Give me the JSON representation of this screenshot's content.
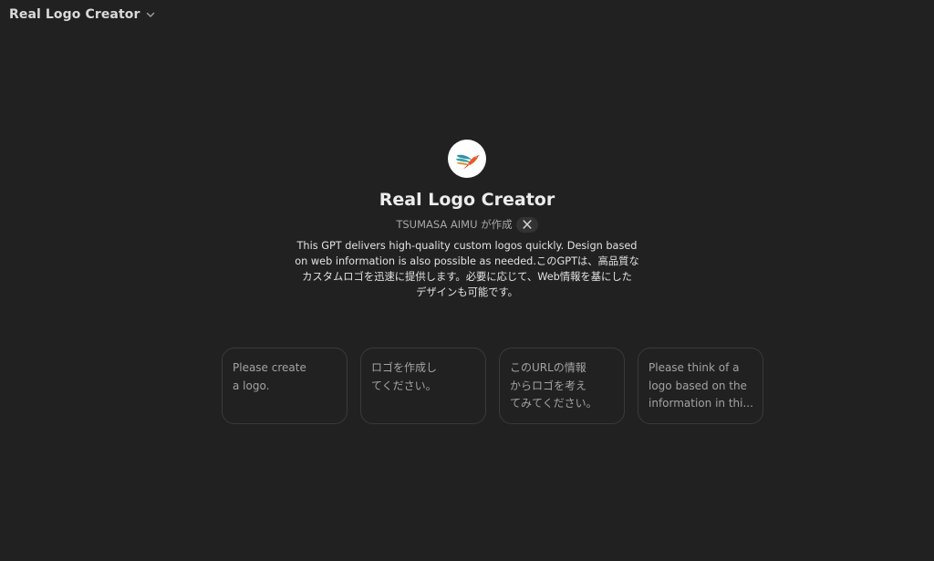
{
  "header": {
    "title": "Real Logo Creator"
  },
  "gpt": {
    "name": "Real Logo Creator",
    "author": "TSUMASA AIMU が作成",
    "description_lines": [
      "This GPT delivers high-quality custom logos quickly. Design based",
      "on web information is also possible as needed.このGPTは、高品質な",
      "カスタムロゴを迅速に提供します。必要に応じて、Web情報を基にした",
      "デザインも可能です。"
    ]
  },
  "starters": [
    {
      "lines": [
        "Please create",
        "a logo."
      ]
    },
    {
      "lines": [
        "ロゴを作成し",
        "てください。"
      ]
    },
    {
      "lines": [
        "このURLの情報",
        "からロゴを考え",
        "てみてください。"
      ]
    },
    {
      "lines": [
        "Please think of a",
        "logo based on the",
        "information in thi..."
      ]
    }
  ],
  "icons": {
    "header_chevron": "chevron-down-icon",
    "avatar": "bird-logo-icon",
    "social": "x-logo-icon"
  }
}
